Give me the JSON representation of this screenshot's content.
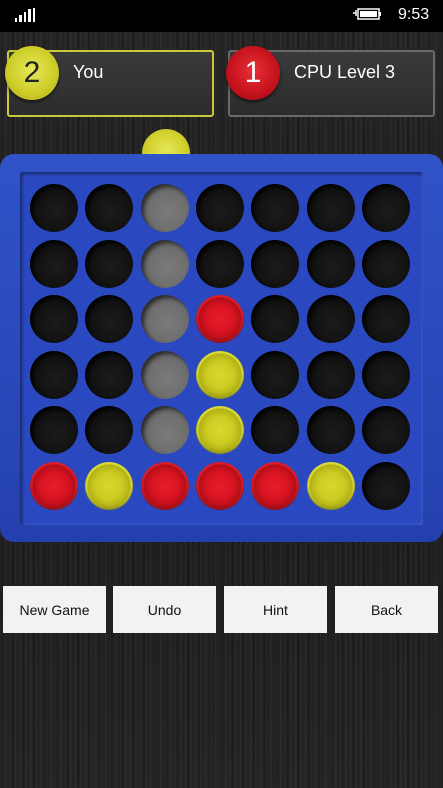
{
  "status_bar": {
    "time": "9:53"
  },
  "players": {
    "you": {
      "badge": "2",
      "name": "You",
      "color": "#d0d02b"
    },
    "cpu": {
      "badge": "1",
      "name": "CPU Level 3",
      "color": "#d01a24"
    }
  },
  "board": {
    "columns": 7,
    "rows": 6,
    "highlight_column": 2,
    "grid": [
      [
        "empty",
        "empty",
        "empty",
        "empty",
        "empty",
        "empty",
        "empty"
      ],
      [
        "empty",
        "empty",
        "empty",
        "empty",
        "empty",
        "empty",
        "empty"
      ],
      [
        "empty",
        "empty",
        "empty",
        "red",
        "empty",
        "empty",
        "empty"
      ],
      [
        "empty",
        "empty",
        "empty",
        "yellow",
        "empty",
        "empty",
        "empty"
      ],
      [
        "empty",
        "empty",
        "empty",
        "yellow",
        "empty",
        "empty",
        "empty"
      ],
      [
        "red",
        "yellow",
        "red",
        "red",
        "red",
        "yellow",
        "empty"
      ]
    ]
  },
  "buttons": {
    "new_game": "New Game",
    "undo": "Undo",
    "hint": "Hint",
    "back": "Back"
  }
}
